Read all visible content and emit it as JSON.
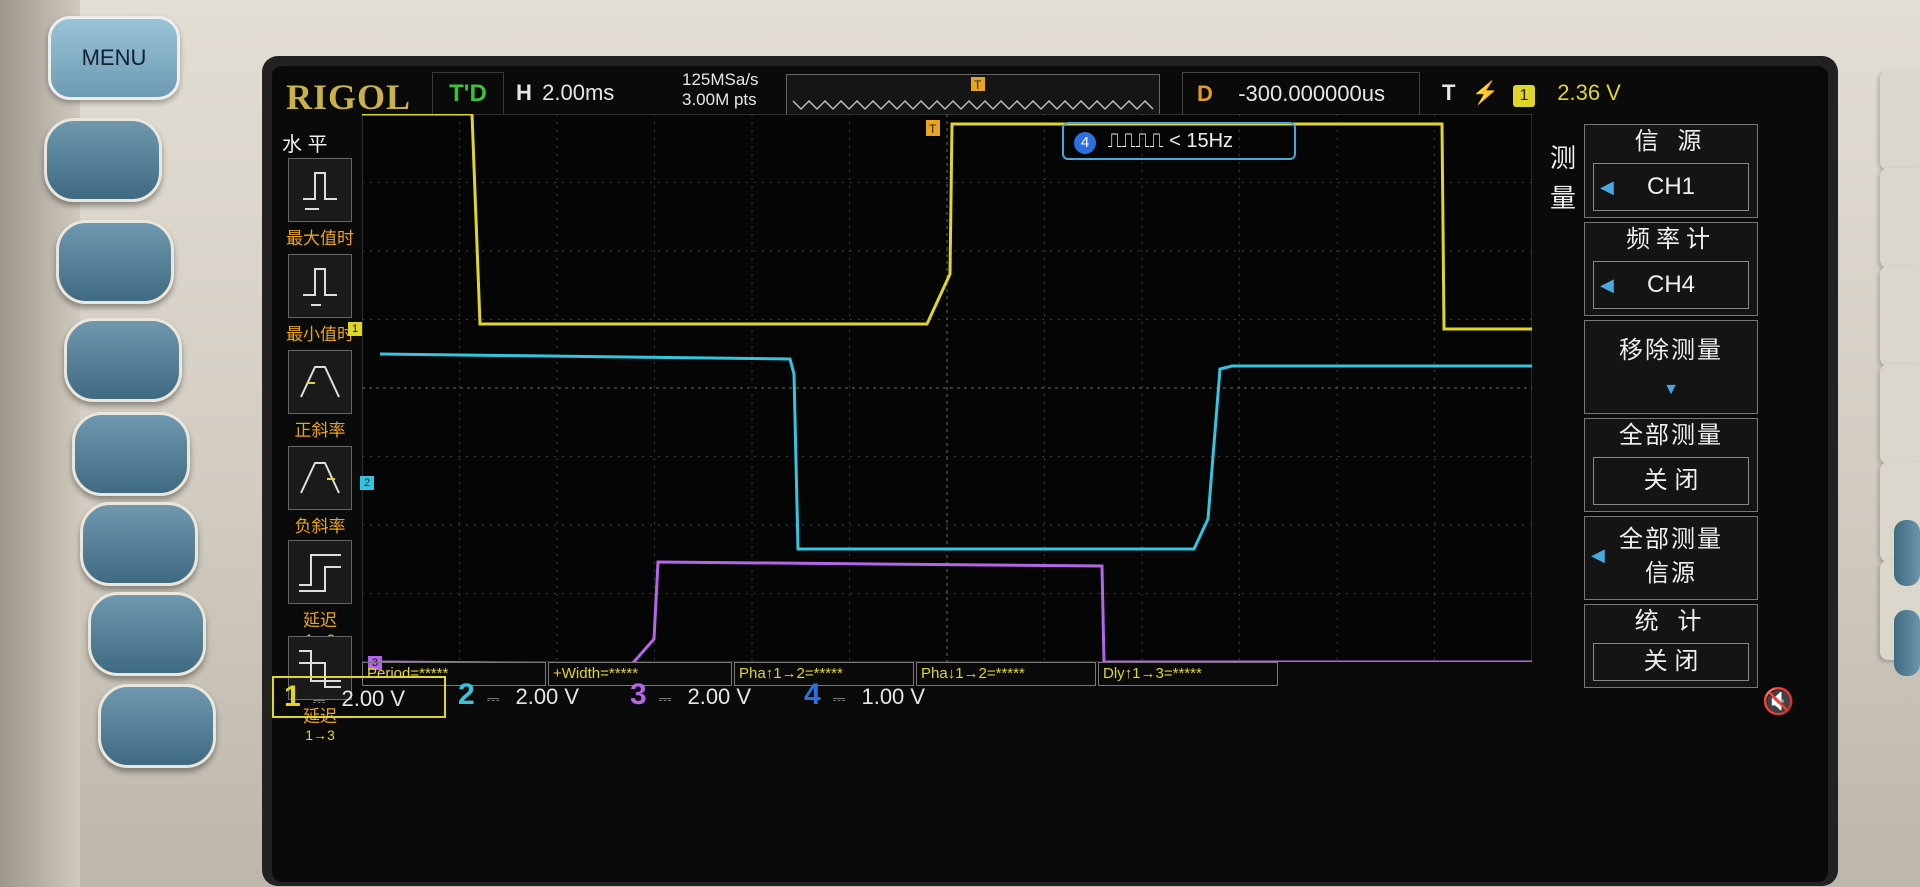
{
  "front_panel": {
    "menu_label": "MENU"
  },
  "header": {
    "brand": "RIGOL",
    "status": "T'D",
    "horizontal_label": "H",
    "timebase": "2.00ms",
    "sample_rate": "125MSa/s",
    "memory_depth": "3.00M pts",
    "delay_label": "D",
    "delay_value": "-300.000000us",
    "trigger_label": "T",
    "trigger_edge_icon": "rising-edge-icon",
    "trigger_source": "1",
    "trigger_level": "2.36 V"
  },
  "left_menu": {
    "title": "水 平",
    "items": [
      {
        "label": "最大值时刻",
        "sub": ""
      },
      {
        "label": "最小值时刻",
        "sub": ""
      },
      {
        "label": "正斜率",
        "sub": ""
      },
      {
        "label": "负斜率",
        "sub": ""
      },
      {
        "label": "延迟",
        "sub": "1→3"
      },
      {
        "label": "延迟",
        "sub": "1→3"
      }
    ]
  },
  "right_menu": {
    "vertical_title": [
      "测",
      "量"
    ],
    "source_label": "信 源",
    "source_value": "CH1",
    "counter_label": "频率计",
    "counter_value": "CH4",
    "remove_label": "移除测量",
    "all_label": "全部测量",
    "all_value": "关 闭",
    "all_source_label": "全部测量\n信源",
    "stats_label": "统 计",
    "stats_value": "关 闭"
  },
  "counter_badge": {
    "channel": "4",
    "text": "< 15Hz"
  },
  "cursor_bar": {
    "items": [
      "Period=*****",
      "+Width=*****",
      "Pha↑1→2=*****",
      "Pha↓1→2=*****",
      "Dly↑1→3=*****"
    ]
  },
  "channels": [
    {
      "num": "1",
      "scale": "2.00 V",
      "color": "#e0d52a"
    },
    {
      "num": "2",
      "scale": "2.00 V",
      "color": "#34c6e0"
    },
    {
      "num": "3",
      "scale": "2.00 V",
      "color": "#b465e8"
    },
    {
      "num": "4",
      "scale": "1.00 V",
      "color": "#2d6fe0"
    }
  ],
  "markers": {
    "ch1": "1",
    "ch2": "2",
    "ch3": "3",
    "trigger": "T"
  },
  "colors": {
    "ch1": "#e0d52a",
    "ch2": "#34c6e0",
    "ch3": "#b465e8",
    "ch4": "#2d6fe0",
    "accent": "#e8a51c"
  }
}
